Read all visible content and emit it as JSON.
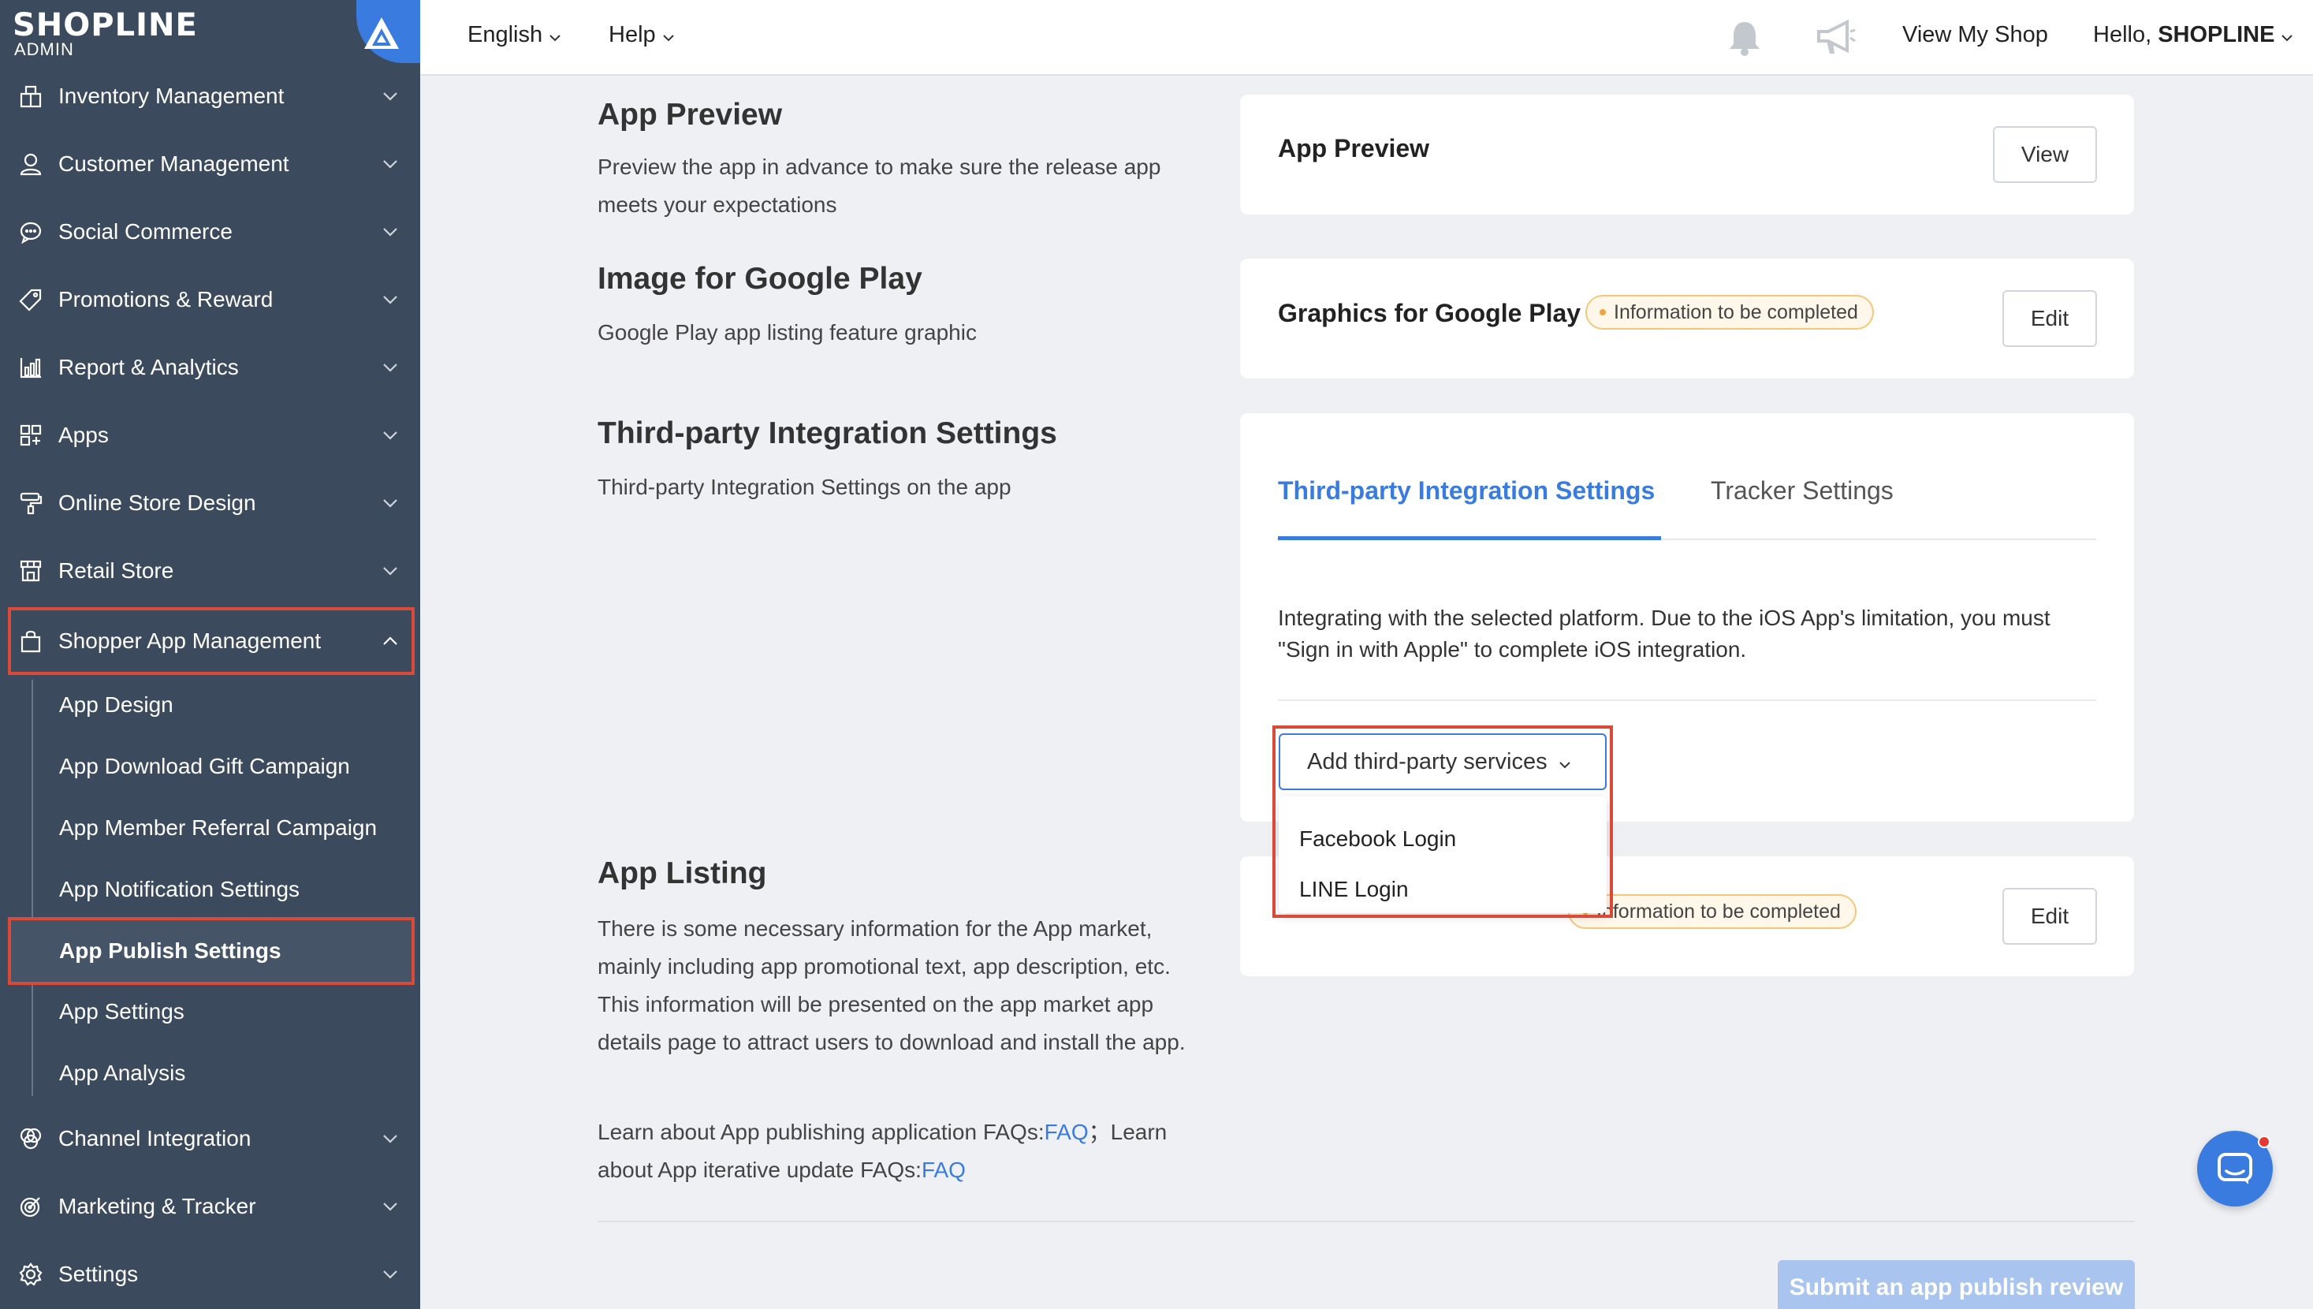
{
  "brand": {
    "name": "SHOPLINE",
    "sub": "ADMIN"
  },
  "sidebar": {
    "items": [
      {
        "label": "Inventory Management",
        "icon": "inventory-icon"
      },
      {
        "label": "Customer Management",
        "icon": "person-icon"
      },
      {
        "label": "Social Commerce",
        "icon": "chat-bubble-icon"
      },
      {
        "label": "Promotions & Reward",
        "icon": "tag-icon"
      },
      {
        "label": "Report & Analytics",
        "icon": "bar-chart-icon"
      },
      {
        "label": "Apps",
        "icon": "apps-grid-icon"
      },
      {
        "label": "Online Store Design",
        "icon": "paint-roller-icon"
      },
      {
        "label": "Retail Store",
        "icon": "store-icon"
      },
      {
        "label": "Shopper App Management",
        "icon": "shopping-bag-icon"
      },
      {
        "label": "Channel Integration",
        "icon": "channels-icon"
      },
      {
        "label": "Marketing & Tracker",
        "icon": "target-icon"
      },
      {
        "label": "Settings",
        "icon": "gear-icon"
      }
    ],
    "sub_items": [
      "App Design",
      "App Download Gift Campaign",
      "App Member Referral Campaign",
      "App Notification Settings",
      "App Publish Settings",
      "App Settings",
      "App Analysis"
    ]
  },
  "topbar": {
    "language": "English",
    "help": "Help",
    "view_shop": "View My Shop",
    "greeting_prefix": "Hello, ",
    "greeting_name": "SHOPLINE"
  },
  "sections": {
    "preview": {
      "title": "App Preview",
      "desc": "Preview the app in advance to make sure the release app meets your expectations",
      "card_title": "App Preview",
      "button": "View"
    },
    "google_play": {
      "title": "Image for Google Play",
      "desc": "Google Play app listing feature graphic",
      "card_title": "Graphics for Google Play",
      "badge": "Information to be completed",
      "button": "Edit"
    },
    "third_party": {
      "title": "Third-party Integration Settings",
      "desc": "Third-party Integration Settings on the app",
      "tabs": [
        "Third-party Integration Settings",
        "Tracker Settings"
      ],
      "info": "Integrating with the selected platform. Due to the iOS App's limitation, you must \"Sign in with Apple\" to complete iOS integration.",
      "add_button": "Add third-party services",
      "menu": [
        "Facebook Login",
        "LINE Login"
      ]
    },
    "listing": {
      "title": "App Listing",
      "desc": "There is some necessary information for the App market, mainly including app promotional text, app description, etc. This information will be presented on the app market app details page to attract users to download and install the app.",
      "faq_text_1": "Learn about App publishing application FAQs:",
      "faq_link_1": "FAQ",
      "faq_text_2": "；Learn about App iterative update FAQs:",
      "faq_link_2": "FAQ",
      "badge": "Information to be completed",
      "button": "Edit"
    }
  },
  "submit_button": "Submit an app publish review",
  "colors": {
    "sidebar_bg": "#3b4a5c",
    "accent": "#3a7be0",
    "highlight": "#d94a38",
    "badge_border": "#f5c779"
  }
}
